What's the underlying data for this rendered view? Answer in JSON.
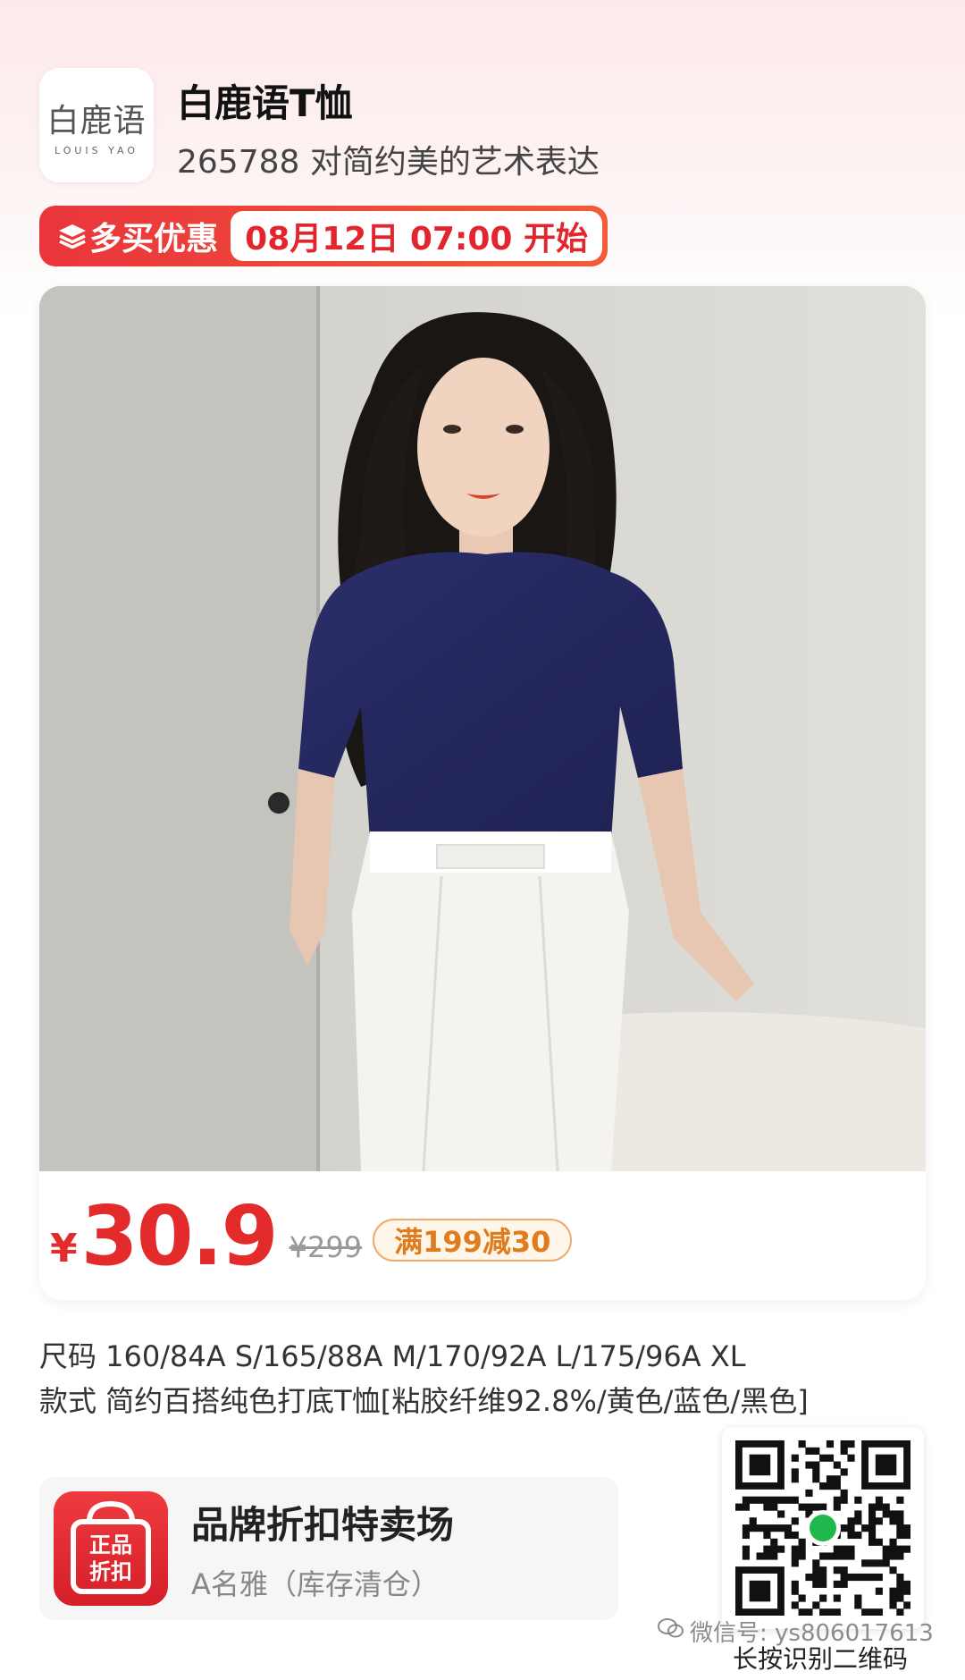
{
  "header": {
    "logo_cn": "白鹿语",
    "logo_en": "LOUIS YAO",
    "title": "白鹿语T恤",
    "subtitle": "265788 对简约美的艺术表达"
  },
  "promo": {
    "label": "多买优惠",
    "time": "08月12日 07:00 开始",
    "icon": "stack-layers-icon"
  },
  "product": {
    "image": "model-wearing-navy-tshirt-white-trousers",
    "currency": "¥",
    "price": "30.9",
    "original_price": "¥299",
    "coupon": "满199减30"
  },
  "specs": {
    "size": "尺码 160/84A S/165/88A M/170/92A L/175/96A XL",
    "style": "款式 简约百搭纯色打底T恤[粘胶纤维92.8%/黄色/蓝色/黑色]"
  },
  "store": {
    "badge_line1": "正品",
    "badge_line2": "折扣",
    "title": "品牌折扣特卖场",
    "subtitle": "A名雅（库存清仓）"
  },
  "qr": {
    "caption": "长按识别二维码"
  },
  "watermark": {
    "text": "微信号: ys806017613"
  },
  "colors": {
    "accent_red": "#e32b2b",
    "coupon_orange": "#e07b1e",
    "shirt_navy": "#25285e"
  }
}
